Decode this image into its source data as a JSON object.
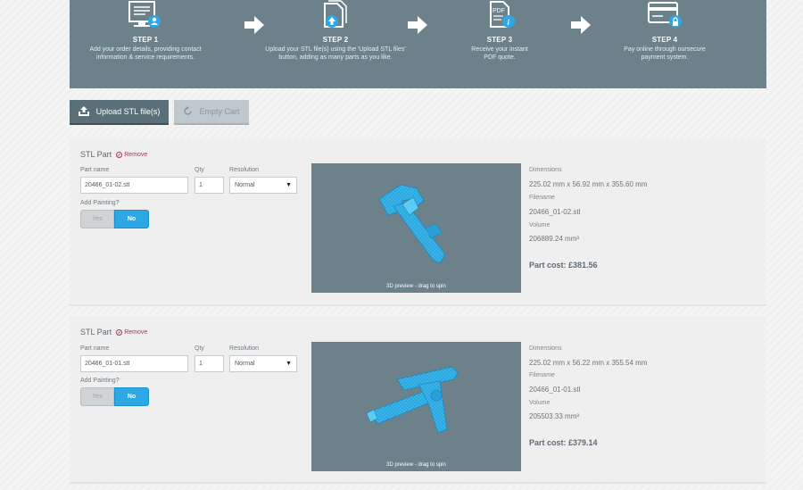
{
  "steps": [
    {
      "title": "STEP 1",
      "desc_line1": "Add your order details, providing contact",
      "desc_line2": "information & service requirements."
    },
    {
      "title": "STEP 2",
      "desc_line1": "Upload your STL file(s) using the 'Upload STL files'",
      "desc_line2": "button, adding as many parts as you like."
    },
    {
      "title": "STEP 3",
      "desc_line1": "Receive your instant",
      "desc_line2": "PDF quote."
    },
    {
      "title": "STEP 4",
      "desc_line1": "Pay online through oursecure",
      "desc_line2": "payment system."
    }
  ],
  "toolbar": {
    "upload_label": "Upload STL file(s)",
    "empty_label": "Empty Cart"
  },
  "labels": {
    "part_title": "STL Part",
    "remove": "Remove",
    "part_name": "Part name",
    "qty": "Qty",
    "resolution": "Resolution",
    "add_painting": "Add Painting?",
    "yes": "Yes",
    "no": "No",
    "preview_caption": "3D preview - drag to spin",
    "dimensions": "Dimensions",
    "filename": "Filename",
    "volume": "Volume"
  },
  "parts": [
    {
      "part_name": "20466_01-02.stl",
      "qty": "1",
      "resolution": "Normal",
      "dimensions": "225.02 mm x 56.92 mm x 355.60 mm",
      "filename": "20466_01-02.stl",
      "volume": "206889.24 mm³",
      "cost": "Part cost: £381.56"
    },
    {
      "part_name": "20466_01-01.stl",
      "qty": "1",
      "resolution": "Normal",
      "dimensions": "225.02 mm x 56.22 mm x 355.54 mm",
      "filename": "20466_01-01.stl",
      "volume": "205503.33 mm³",
      "cost": "Part cost: £379.14"
    }
  ],
  "colors": {
    "banner": "#6c818a",
    "accent": "#2ea8e5",
    "remove": "#9c3a5a",
    "model": "#39b4ea"
  },
  "icons": {
    "step1": "monitor-user-icon",
    "step2": "upload-files-icon",
    "step3": "pdf-info-icon",
    "step4": "card-lock-icon",
    "arrow": "arrow-right-icon",
    "upload": "upload-icon",
    "empty": "refresh-icon",
    "remove": "remove-circle-icon"
  }
}
